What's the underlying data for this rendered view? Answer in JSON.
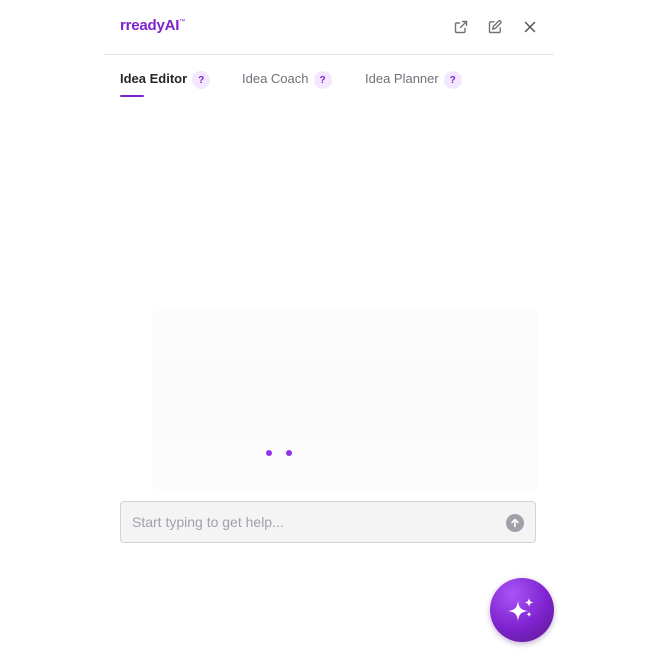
{
  "header": {
    "logo_text": "rreadyAI",
    "logo_mark": "™",
    "icons": [
      "external-link-icon",
      "edit-icon",
      "close-icon"
    ]
  },
  "tabs": [
    {
      "label": "Idea Editor",
      "help": "?",
      "active": true
    },
    {
      "label": "Idea Coach",
      "help": "?",
      "active": false
    },
    {
      "label": "Idea Planner",
      "help": "?",
      "active": false
    }
  ],
  "chat": {
    "placeholder": "Start typing to get help...",
    "value": "",
    "send_icon": "arrow-up-icon"
  },
  "fab": {
    "icon": "sparkles-icon"
  },
  "colors": {
    "brand": "#7e22ce",
    "accent_light": "#f3e8ff",
    "loading_dot": "#9333ea"
  }
}
